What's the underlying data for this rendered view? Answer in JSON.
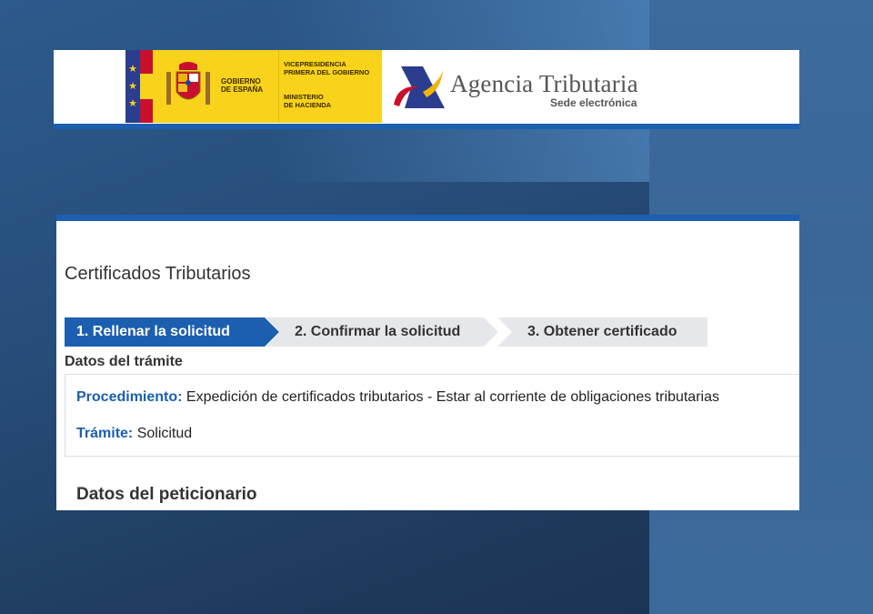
{
  "header": {
    "gov_line1": "GOBIERNO",
    "gov_line2": "DE ESPAÑA",
    "vice_line1": "VICEPRESIDENCIA",
    "vice_line2": "PRIMERA DEL GOBIERNO",
    "ministry_line1": "MINISTERIO",
    "ministry_line2": "DE HACIENDA",
    "agency_title": "Agencia Tributaria",
    "agency_subtitle": "Sede electrónica",
    "eu_star_icon": "eu-star-icon",
    "coat_icon": "coat-of-arms-icon",
    "agency_logo_icon": "agencia-tributaria-logo-icon"
  },
  "page": {
    "title": "Certificados Tributarios"
  },
  "steps": [
    {
      "label": "1. Rellenar la solicitud",
      "state": "active"
    },
    {
      "label": "2. Confirmar la solicitud",
      "state": "pending"
    },
    {
      "label": "3. Obtener certificado",
      "state": "pending"
    }
  ],
  "tramite": {
    "section_label": "Datos del trámite",
    "procedimiento_key": "Procedimiento:",
    "procedimiento_value": " Expedición de certificados tributarios - Estar al corriente de obligaciones tributarias",
    "tramite_key": "Trámite:",
    "tramite_value": " Solicitud"
  },
  "peticionario": {
    "section_label": "Datos del peticionario"
  },
  "colors": {
    "accent_blue": "#1c5fb0",
    "gov_yellow": "#f8d21b",
    "step_inactive": "#e6e7ea"
  }
}
